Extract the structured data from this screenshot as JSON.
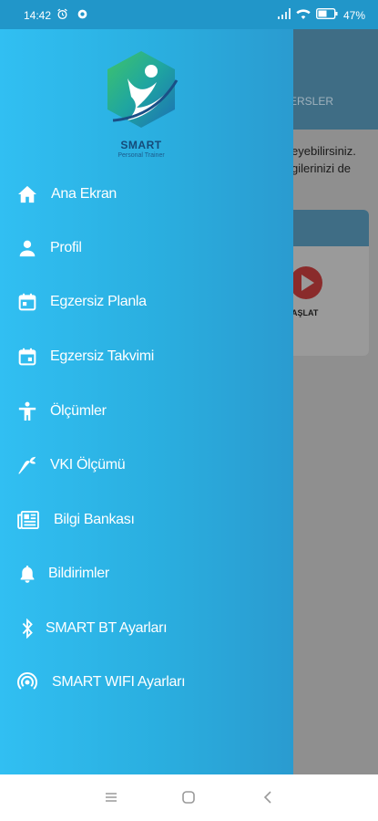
{
  "status_bar": {
    "time": "14:42",
    "battery": "47"
  },
  "background": {
    "tab_text": "ERSLER",
    "body_lines": [
      "eyebilirsiniz.",
      "gilerinizi de"
    ],
    "start_label": "AŞLAT"
  },
  "drawer": {
    "logo_title": "SMART",
    "logo_subtitle": "Personal Trainer",
    "items": [
      {
        "label": "Ana Ekran",
        "icon": "home-icon"
      },
      {
        "label": "Profil",
        "icon": "person-icon"
      },
      {
        "label": "Egzersiz Planla",
        "icon": "calendar-icon"
      },
      {
        "label": "Egzersiz Takvimi",
        "icon": "calendar-event-icon"
      },
      {
        "label": "Ölçümler",
        "icon": "accessibility-icon"
      },
      {
        "label": "VKI Ölçümü",
        "icon": "carrot-icon"
      },
      {
        "label": "Bilgi Bankası",
        "icon": "newspaper-icon"
      },
      {
        "label": "Bildirimler",
        "icon": "bell-icon"
      },
      {
        "label": "SMART BT Ayarları",
        "icon": "bluetooth-icon"
      },
      {
        "label": "SMART WIFI Ayarları",
        "icon": "wifi-tethering-icon"
      }
    ]
  },
  "colors": {
    "drawer_start": "#31bff2",
    "drawer_end": "#2a9bd0",
    "status_bar": "#2196c9",
    "logo_text": "#154b7a"
  }
}
